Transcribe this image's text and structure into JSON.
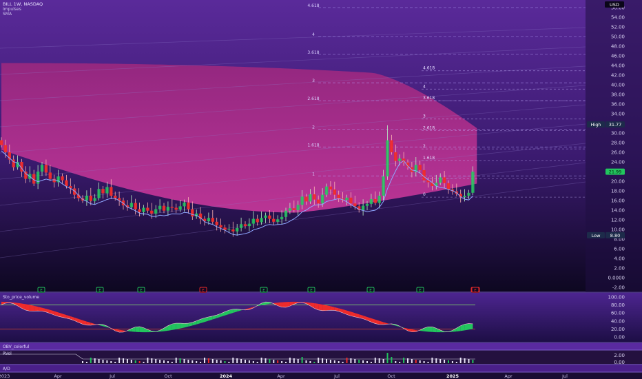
{
  "header": {
    "symbol": "BILL 1W, NASDAQ",
    "indicators": [
      "Impulses",
      "SMA"
    ],
    "currency": "USD"
  },
  "colors": {
    "background_top": "#5a2a9a",
    "background_bottom": "#0d0720",
    "up": "#22c55e",
    "down": "#ef2b2b",
    "cloud": "#b02a8a",
    "sma": "#8fa8ff",
    "text": "#c9c2e0",
    "high_label": "#1e2a44",
    "price_label": "#22c55e"
  },
  "chart_data": [
    {
      "type": "candlestick",
      "title": "",
      "y_axis_ticks": [
        "56.00",
        "54.00",
        "52.00",
        "50.00",
        "48.00",
        "46.00",
        "44.00",
        "42.00",
        "40.00",
        "38.00",
        "36.00",
        "34.00",
        "32.00",
        "30.00",
        "28.00",
        "26.00",
        "24.00",
        "22.00",
        "20.00",
        "18.00",
        "16.00",
        "14.00",
        "12.00",
        "10.00",
        "8.00",
        "6.00",
        "4.00",
        "2.00",
        "0.0000",
        "-2.00"
      ],
      "ylim": [
        -3,
        57
      ],
      "x_axis_ticks": [
        "2023",
        "Apr",
        "Jul",
        "Oct",
        "2024",
        "Apr",
        "Jul",
        "Oct",
        "2025",
        "Apr",
        "Jul"
      ],
      "price_labels": [
        {
          "label": "High",
          "value": 31.77,
          "text": "31.77"
        },
        {
          "label": "",
          "value": 21.99,
          "text": "21.99"
        },
        {
          "label": "Low",
          "value": 8.8,
          "text": "8.80"
        }
      ],
      "fib_upper": [
        {
          "label": "4.618",
          "value": 56.0
        },
        {
          "label": "4",
          "value": 50.0
        },
        {
          "label": "3.618",
          "value": 46.3
        },
        {
          "label": "3",
          "value": 40.4
        },
        {
          "label": "2.618",
          "value": 36.7
        },
        {
          "label": "2",
          "value": 30.8
        },
        {
          "label": "1.618",
          "value": 27.1
        },
        {
          "label": "1",
          "value": 21.1
        }
      ],
      "fib_lower": [
        {
          "label": "4.618",
          "value": 42.9
        },
        {
          "label": "4",
          "value": 39.1
        },
        {
          "label": "3.618",
          "value": 36.7
        },
        {
          "label": "3",
          "value": 32.9
        },
        {
          "label": "2.618",
          "value": 30.5
        },
        {
          "label": "2",
          "value": 26.7
        },
        {
          "label": "1.618",
          "value": 24.3
        },
        {
          "label": "1",
          "value": 20.5
        },
        {
          "label": "0",
          "value": 16.7
        }
      ],
      "closes": [
        27.5,
        26.0,
        24.5,
        22.9,
        24.0,
        22.0,
        20.5,
        21.5,
        19.5,
        22.0,
        23.4,
        21.8,
        20.5,
        19.8,
        21.0,
        20.2,
        19.0,
        18.5,
        17.2,
        16.5,
        16.0,
        17.0,
        15.9,
        16.5,
        18.4,
        17.5,
        18.8,
        17.0,
        16.5,
        16.0,
        15.0,
        14.6,
        15.5,
        14.2,
        13.6,
        14.5,
        13.9,
        13.3,
        14.2,
        14.9,
        13.9,
        14.7,
        14.5,
        14.1,
        14.8,
        15.6,
        14.2,
        12.7,
        13.3,
        12.2,
        11.7,
        12.4,
        11.6,
        10.9,
        10.4,
        9.9,
        10.0,
        9.6,
        10.3,
        11.1,
        10.7,
        11.2,
        12.2,
        11.5,
        12.4,
        12.9,
        12.2,
        11.6,
        12.1,
        12.6,
        13.9,
        14.4,
        14.0,
        15.1,
        16.8,
        15.8,
        17.3,
        16.2,
        15.4,
        17.2,
        18.9,
        18.3,
        17.2,
        16.4,
        16.1,
        16.6,
        15.4,
        14.8,
        14.0,
        14.9,
        15.3,
        16.3,
        15.5,
        17.0,
        21.0,
        28.5,
        26.0,
        24.2,
        24.7,
        23.9,
        22.9,
        21.9,
        23.4,
        22.3,
        20.2,
        19.8,
        19.0,
        19.7,
        20.8,
        19.6,
        18.3,
        17.9,
        17.4,
        16.7,
        17.0,
        17.6,
        21.99
      ],
      "series": [
        {
          "name": "Sto_price_volume",
          "ylim": [
            -10,
            105
          ],
          "ticks": [
            "100.00",
            "80.00",
            "60.00",
            "40.00",
            "20.00",
            "0.00"
          ],
          "levels": [
            80,
            20
          ]
        },
        {
          "name": "OBV_colorful"
        },
        {
          "name": "RVol",
          "ticks": [
            "2.00",
            "0.00"
          ]
        },
        {
          "name": "A/D"
        }
      ],
      "impulse_signals": [
        "E",
        "E",
        "E",
        "E",
        "E",
        "E",
        "E",
        "E",
        "E",
        "E",
        "E"
      ]
    }
  ]
}
